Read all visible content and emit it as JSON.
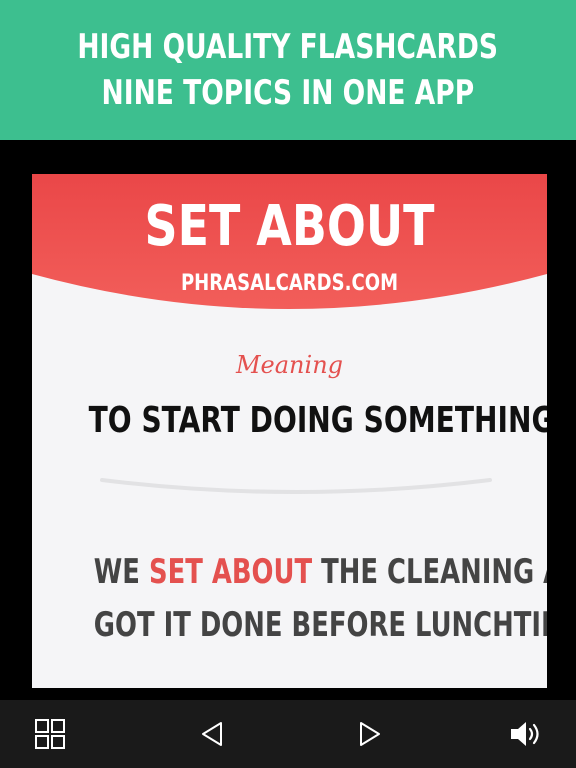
{
  "header": {
    "line1": "HIGH QUALITY FLASHCARDS",
    "line2": "NINE TOPICS IN ONE APP",
    "background": "#3dbf8f"
  },
  "card": {
    "title": "SET ABOUT",
    "site": "PHRASALCARDS.COM",
    "meaning_label": "Meaning",
    "meaning_text": "TO START DOING SOMETHING",
    "example": {
      "line1_before": "WE ",
      "line1_highlight": "SET ABOUT",
      "line1_after": " THE CLEANING AND",
      "line2": "GOT IT DONE BEFORE LUNCHTIME"
    },
    "accent": "#e4514f"
  },
  "toolbar": {
    "buttons": [
      {
        "icon": "grid-icon"
      },
      {
        "icon": "previous-icon"
      },
      {
        "icon": "next-icon"
      },
      {
        "icon": "speaker-icon"
      }
    ]
  }
}
